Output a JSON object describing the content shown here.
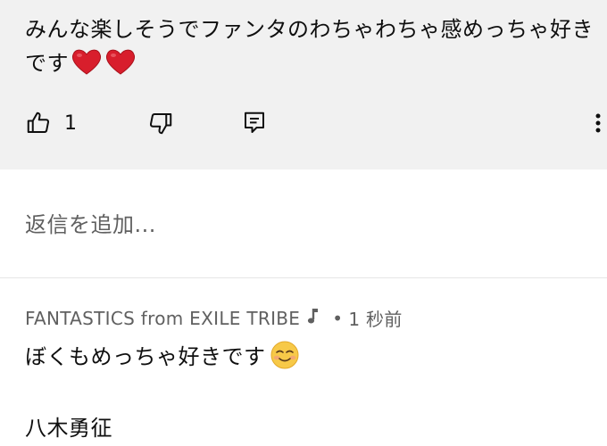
{
  "top_comment": {
    "text": "みんな楽しそうでファンタのわちゃわちゃ感めっちゃ好きです",
    "emojis": [
      "red-heart",
      "red-heart"
    ],
    "like_count": "1"
  },
  "reply_input": {
    "placeholder": "返信を追加..."
  },
  "reply": {
    "author": "FANTASTICS from EXILE TRIBE",
    "author_badge": "music-note",
    "separator": "•",
    "timestamp": "1 秒前",
    "text_line1": "ぼくもめっちゃ好きです",
    "emoji": "smiling-face",
    "text_line2": "八木勇征"
  },
  "colors": {
    "comment_bg": "#f1f1f1",
    "primary_text": "#0f0f0f",
    "secondary_text": "#606060",
    "heart": "#d81e2c"
  }
}
